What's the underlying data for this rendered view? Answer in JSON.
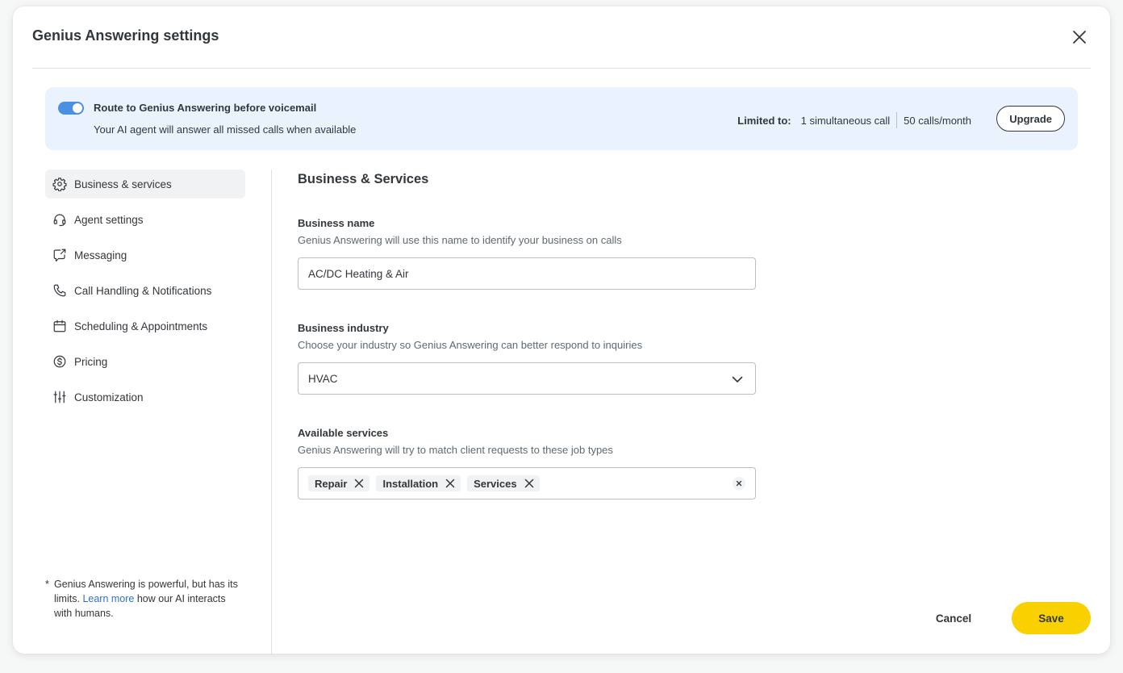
{
  "modal": {
    "title": "Genius Answering settings"
  },
  "banner": {
    "toggle_on": true,
    "title": "Route to Genius Answering before voicemail",
    "subtitle": "Your AI agent will answer all missed calls when available",
    "limits_label": "Limited to:",
    "limit_calls": "1 simultaneous call",
    "limit_month": "50 calls/month",
    "upgrade_label": "Upgrade",
    "accent": "#4a90e2",
    "background": "#eaf3fd"
  },
  "sidebar": {
    "items": [
      {
        "label": "Business & services",
        "icon": "gear-icon",
        "active": true
      },
      {
        "label": "Agent settings",
        "icon": "headset-icon"
      },
      {
        "label": "Messaging",
        "icon": "chat-share-icon"
      },
      {
        "label": "Call Handling & Notifications",
        "icon": "phone-icon"
      },
      {
        "label": "Scheduling & Appointments",
        "icon": "calendar-icon"
      },
      {
        "label": "Pricing",
        "icon": "dollar-icon"
      },
      {
        "label": "Customization",
        "icon": "sliders-icon"
      }
    ]
  },
  "footnote": {
    "mark": "*",
    "text_before": "Genius Answering is powerful, but has its limits.",
    "link": "Learn more",
    "text_after": "how our AI interacts with humans."
  },
  "section": {
    "title": "Business & Services",
    "business_name": {
      "label": "Business name",
      "description": "Genius Answering will use this name to identify your business on calls",
      "value": "AC/DC Heating & Air"
    },
    "business_industry": {
      "label": "Business industry",
      "description": "Choose your industry so Genius Answering can better respond to inquiries",
      "value": "HVAC"
    },
    "available_services": {
      "label": "Available services",
      "description": "Genius Answering will try to match client requests to these job types",
      "chips": [
        "Repair",
        "Installation",
        "Services"
      ]
    }
  },
  "footer": {
    "cancel_label": "Cancel",
    "save_label": "Save",
    "save_color": "#f9d000"
  }
}
